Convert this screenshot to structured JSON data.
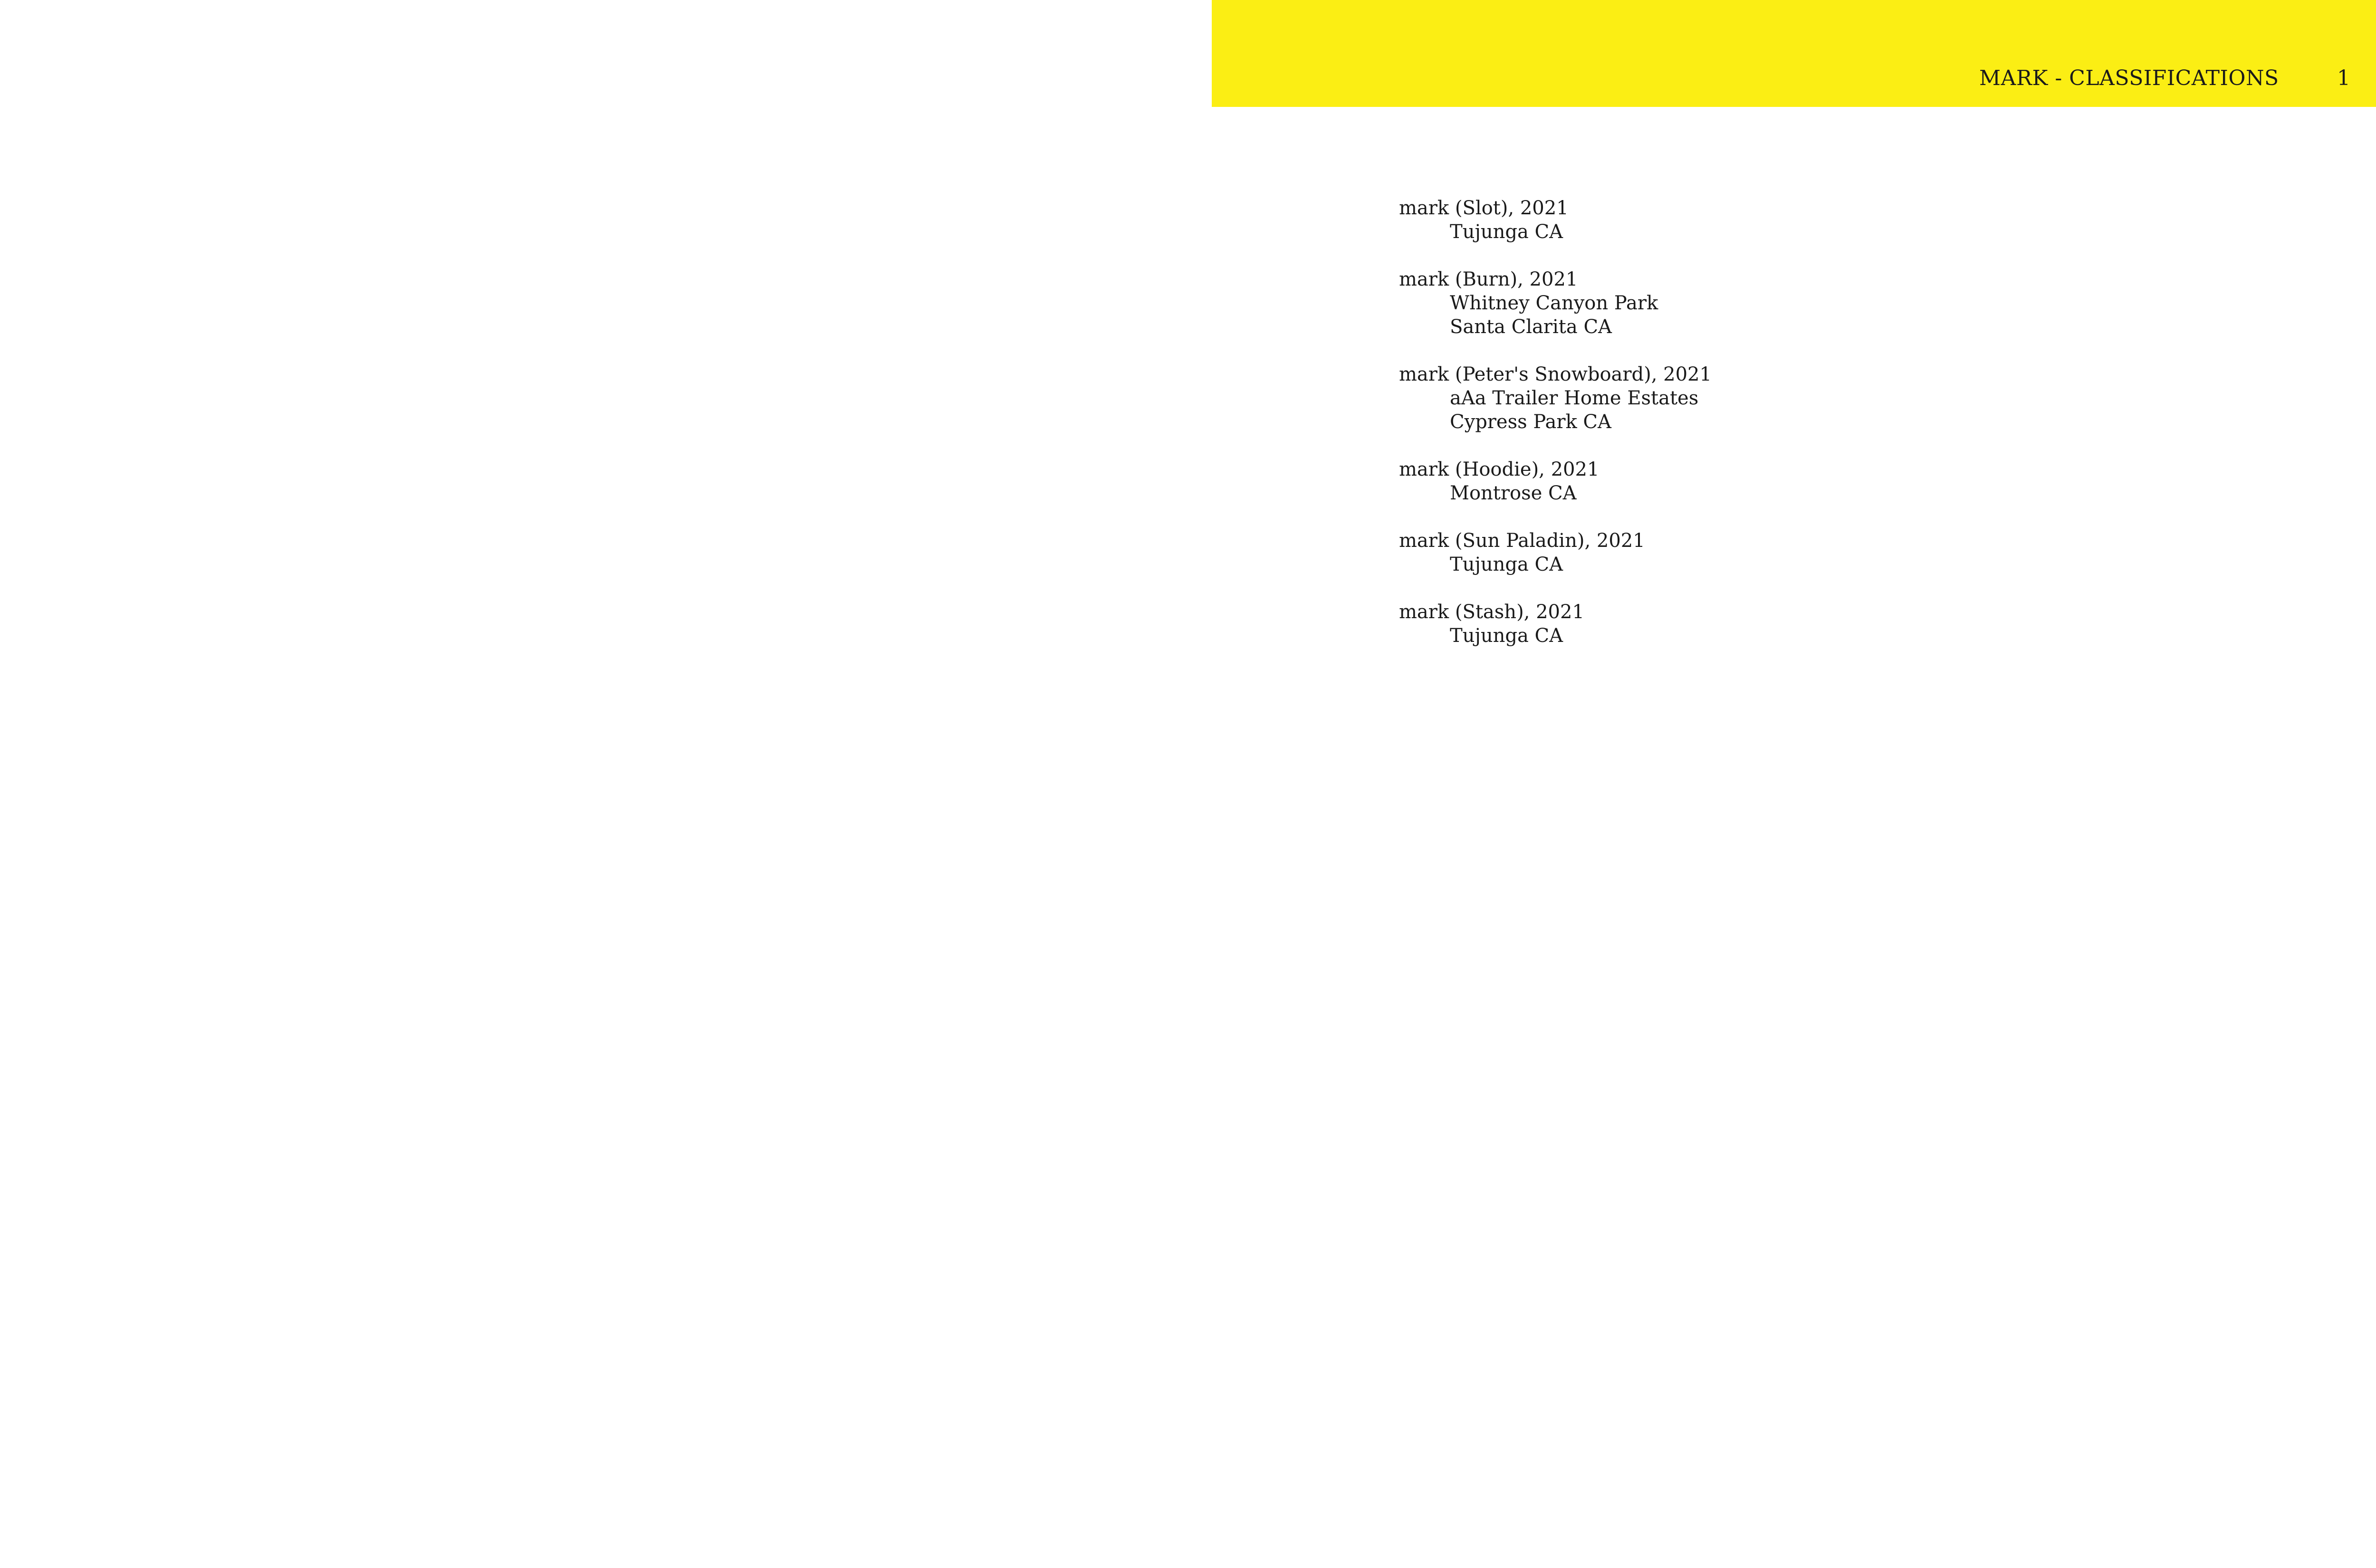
{
  "header": {
    "running_head": "MARK - CLASSIFICATIONS",
    "page_number": "1",
    "band_color": "#fbee14"
  },
  "entries": [
    {
      "title": "mark (Slot), 2021",
      "lines": [
        "Tujunga CA"
      ]
    },
    {
      "title": "mark (Burn), 2021",
      "lines": [
        "Whitney Canyon Park",
        "Santa Clarita CA"
      ]
    },
    {
      "title": "mark (Peter's Snowboard), 2021",
      "lines": [
        "aAa Trailer Home Estates",
        "Cypress Park CA"
      ]
    },
    {
      "title": "mark (Hoodie), 2021",
      "lines": [
        "Montrose CA"
      ]
    },
    {
      "title": "mark (Sun Paladin), 2021",
      "lines": [
        "Tujunga CA"
      ]
    },
    {
      "title": "mark (Stash), 2021",
      "lines": [
        "Tujunga CA"
      ]
    }
  ]
}
